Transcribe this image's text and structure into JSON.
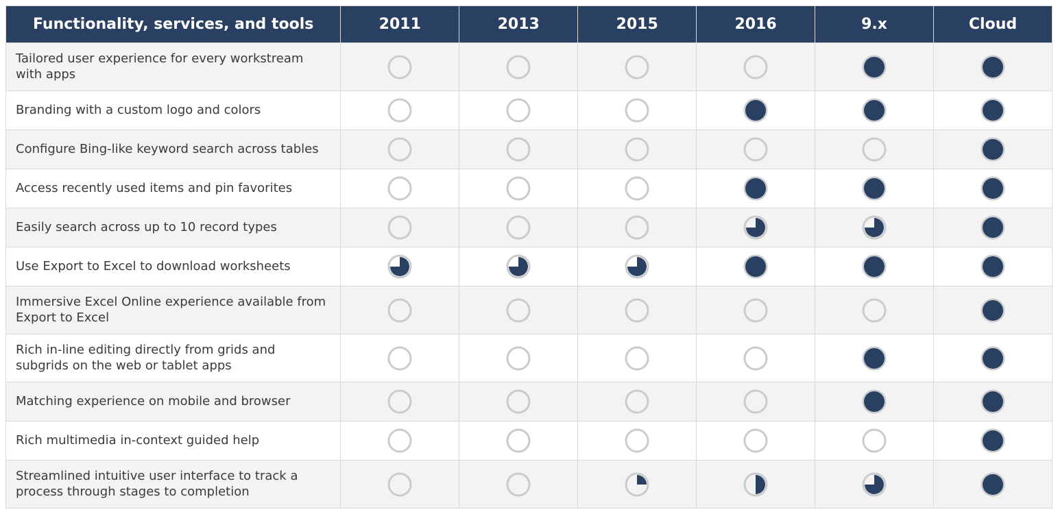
{
  "columns": [
    {
      "key": "feature",
      "label": "Functionality, services, and tools"
    },
    {
      "key": "v2011",
      "label": "2011"
    },
    {
      "key": "v2013",
      "label": "2013"
    },
    {
      "key": "v2015",
      "label": "2015"
    },
    {
      "key": "v2016",
      "label": "2016"
    },
    {
      "key": "v9x",
      "label": "9.x"
    },
    {
      "key": "cloud",
      "label": "Cloud"
    }
  ],
  "rows": [
    {
      "feature": "Tailored user experience for every workstream with apps",
      "v2011": 0,
      "v2013": 0,
      "v2015": 0,
      "v2016": 0,
      "v9x": 100,
      "cloud": 100
    },
    {
      "feature": "Branding with a custom logo and colors",
      "v2011": 0,
      "v2013": 0,
      "v2015": 0,
      "v2016": 100,
      "v9x": 100,
      "cloud": 100
    },
    {
      "feature": "Configure Bing-like keyword search across tables",
      "v2011": 0,
      "v2013": 0,
      "v2015": 0,
      "v2016": 0,
      "v9x": 0,
      "cloud": 100
    },
    {
      "feature": "Access recently used items and pin favorites",
      "v2011": 0,
      "v2013": 0,
      "v2015": 0,
      "v2016": 100,
      "v9x": 100,
      "cloud": 100
    },
    {
      "feature": "Easily search across up to 10 record types",
      "v2011": 0,
      "v2013": 0,
      "v2015": 0,
      "v2016": 75,
      "v9x": 75,
      "cloud": 100
    },
    {
      "feature": "Use Export to Excel to download worksheets",
      "v2011": 75,
      "v2013": 75,
      "v2015": 75,
      "v2016": 100,
      "v9x": 100,
      "cloud": 100
    },
    {
      "feature": "Immersive Excel Online experience available from Export to Excel",
      "v2011": 0,
      "v2013": 0,
      "v2015": 0,
      "v2016": 0,
      "v9x": 0,
      "cloud": 100
    },
    {
      "feature": "Rich in-line editing directly from grids and subgrids on the web or tablet apps",
      "v2011": 0,
      "v2013": 0,
      "v2015": 0,
      "v2016": 0,
      "v9x": 100,
      "cloud": 100
    },
    {
      "feature": "Matching experience on mobile and browser",
      "v2011": 0,
      "v2013": 0,
      "v2015": 0,
      "v2016": 0,
      "v9x": 100,
      "cloud": 100
    },
    {
      "feature": "Rich multimedia in-context guided help",
      "v2011": 0,
      "v2013": 0,
      "v2015": 0,
      "v2016": 0,
      "v9x": 0,
      "cloud": 100
    },
    {
      "feature": "Streamlined intuitive user interface to track a process through stages to completion",
      "v2011": 0,
      "v2013": 0,
      "v2015": 25,
      "v2016": 50,
      "v9x": 75,
      "cloud": 100
    }
  ],
  "chart_data": {
    "type": "table",
    "title": "Functionality availability by version",
    "value_meaning": "percent feature coverage (visual pie fill)",
    "categories": [
      "2011",
      "2013",
      "2015",
      "2016",
      "9.x",
      "Cloud"
    ],
    "series": [
      {
        "name": "Tailored user experience for every workstream with apps",
        "values": [
          0,
          0,
          0,
          0,
          100,
          100
        ]
      },
      {
        "name": "Branding with a custom logo and colors",
        "values": [
          0,
          0,
          0,
          100,
          100,
          100
        ]
      },
      {
        "name": "Configure Bing-like keyword search across tables",
        "values": [
          0,
          0,
          0,
          0,
          0,
          100
        ]
      },
      {
        "name": "Access recently used items and pin favorites",
        "values": [
          0,
          0,
          0,
          100,
          100,
          100
        ]
      },
      {
        "name": "Easily search across up to 10 record types",
        "values": [
          0,
          0,
          0,
          75,
          75,
          100
        ]
      },
      {
        "name": "Use Export to Excel to download worksheets",
        "values": [
          75,
          75,
          75,
          100,
          100,
          100
        ]
      },
      {
        "name": "Immersive Excel Online experience available from Export to Excel",
        "values": [
          0,
          0,
          0,
          0,
          0,
          100
        ]
      },
      {
        "name": "Rich in-line editing directly from grids and subgrids on the web or tablet apps",
        "values": [
          0,
          0,
          0,
          0,
          100,
          100
        ]
      },
      {
        "name": "Matching experience on mobile and browser",
        "values": [
          0,
          0,
          0,
          0,
          100,
          100
        ]
      },
      {
        "name": "Rich multimedia in-context guided help",
        "values": [
          0,
          0,
          0,
          0,
          0,
          100
        ]
      },
      {
        "name": "Streamlined intuitive user interface to track a process through stages to completion",
        "values": [
          0,
          0,
          25,
          50,
          75,
          100
        ]
      }
    ]
  }
}
